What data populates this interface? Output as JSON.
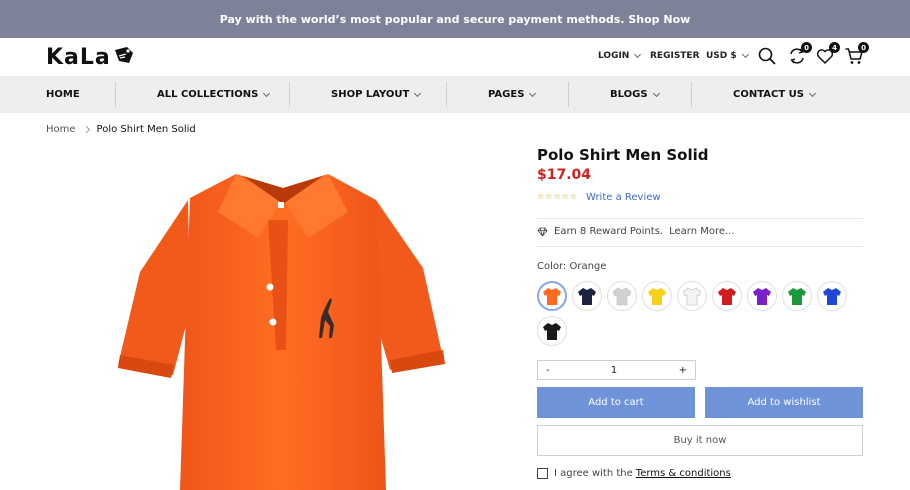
{
  "topbar": {
    "text": "Pay with the world’s most popular and secure payment methods. Shop Now"
  },
  "header": {
    "logo": "KaLa",
    "login": "LOGIN",
    "register": "REGISTER",
    "currency": "USD $",
    "compare_count": "0",
    "wishlist_count": "4",
    "cart_count": "0",
    "icons": [
      "search-icon",
      "compare-icon",
      "heart-icon",
      "cart-icon"
    ]
  },
  "nav": {
    "items": [
      {
        "label": "HOME"
      },
      {
        "label": "ALL COLLECTIONS"
      },
      {
        "label": "SHOP LAYOUT"
      },
      {
        "label": "PAGES"
      },
      {
        "label": "BLOGS"
      },
      {
        "label": "CONTACT US"
      }
    ]
  },
  "breadcrumb": {
    "home": "Home",
    "current": "Polo Shirt Men Solid"
  },
  "product": {
    "title": "Polo Shirt Men Solid",
    "price": "$17.04",
    "rating": 0,
    "review_link": "Write a Review",
    "reward_text": "Earn 8 Reward Points.",
    "reward_link": "Learn More...",
    "color_label": "Color: Orange",
    "colors": [
      {
        "name": "orange",
        "hex": "#ff6a1c",
        "selected": true
      },
      {
        "name": "navy",
        "hex": "#1c2240"
      },
      {
        "name": "light-gray",
        "hex": "#d2d2d2"
      },
      {
        "name": "yellow",
        "hex": "#f5d11a"
      },
      {
        "name": "white",
        "hex": "#f3f3f3"
      },
      {
        "name": "red",
        "hex": "#d01c1c"
      },
      {
        "name": "purple",
        "hex": "#7a1fc9"
      },
      {
        "name": "green",
        "hex": "#1a9a3c"
      },
      {
        "name": "blue",
        "hex": "#1e46d8"
      },
      {
        "name": "black",
        "hex": "#1a1a1a"
      }
    ],
    "quantity": "1",
    "qty_minus": "-",
    "qty_plus": "+",
    "add_to_cart": "Add to cart",
    "add_to_wishlist": "Add to wishlist",
    "buy_now": "Buy it now",
    "agree_text": "I agree with the",
    "terms_link": "Terms & conditions"
  },
  "colors": {
    "topbar_bg": "#7d8299",
    "price": "#d51f1f",
    "button_blue": "#6e93d8",
    "link_blue": "#3d6cc4"
  }
}
